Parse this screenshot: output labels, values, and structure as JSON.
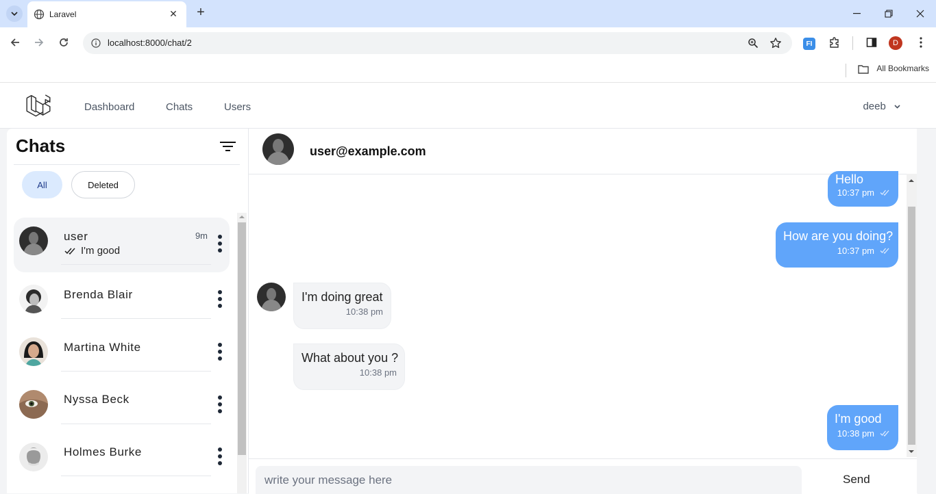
{
  "browser": {
    "tab_title": "Laravel",
    "url": "localhost:8000/chat/2",
    "bookmarks_label": "All Bookmarks",
    "profile_initial": "D",
    "extension_label": "FI"
  },
  "nav": {
    "links": [
      "Dashboard",
      "Chats",
      "Users"
    ],
    "user_name": "deeb"
  },
  "sidebar": {
    "title": "Chats",
    "filters": [
      "All",
      "Deleted"
    ],
    "items": [
      {
        "name": "user",
        "time": "9m",
        "preview": "I'm good"
      },
      {
        "name": "Brenda Blair"
      },
      {
        "name": "Martina White"
      },
      {
        "name": "Nyssa Beck"
      },
      {
        "name": "Holmes Burke"
      }
    ]
  },
  "conversation": {
    "contact": "user@example.com",
    "messages": [
      {
        "text": "Hello",
        "time": "10:37 pm"
      },
      {
        "text": "How are you doing?",
        "time": "10:37 pm"
      },
      {
        "text": "I'm doing great",
        "time": "10:38 pm"
      },
      {
        "text": "What about you ?",
        "time": "10:38 pm"
      },
      {
        "text": "I'm good",
        "time": "10:38 pm"
      }
    ],
    "input_placeholder": "write your message here",
    "send_label": "Send"
  },
  "colors": {
    "outgoing_bubble": "#60a5fa",
    "incoming_bubble": "#f3f4f6",
    "active_filter": "#dbeafe"
  }
}
